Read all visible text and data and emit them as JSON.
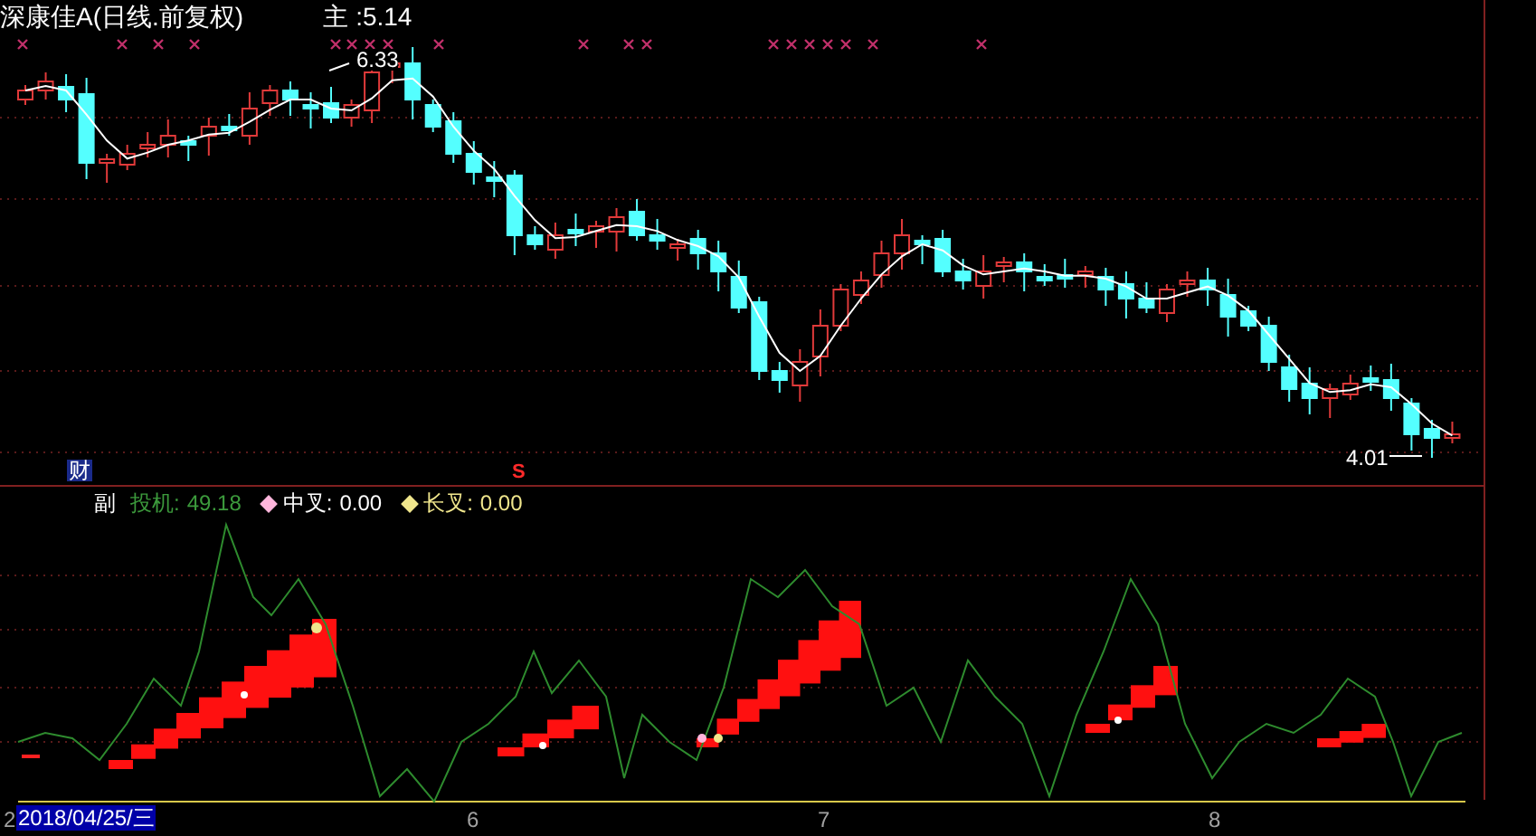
{
  "main_chart": {
    "title": "深康佳A(日线.前复权)",
    "indicator_label": "主",
    "indicator_value": ":5.14",
    "high_label": "6.33",
    "low_label": "4.01",
    "finance_marker": "财",
    "sell_marker": "S"
  },
  "sub_chart": {
    "label": "副",
    "series": [
      {
        "kind": "plain",
        "name": "投机:",
        "value": "49.18",
        "color": "#3c9a3c"
      },
      {
        "kind": "diamond",
        "name": "中叉:",
        "value": "0.00",
        "color": "#ffb6dc"
      },
      {
        "kind": "diamond",
        "name": "长叉:",
        "value": "0.00",
        "color": "#f0e68c"
      }
    ]
  },
  "time_axis": {
    "cursor_date": "2018/04/25/三",
    "labels": [
      "2",
      "6",
      "7",
      "8"
    ]
  }
}
